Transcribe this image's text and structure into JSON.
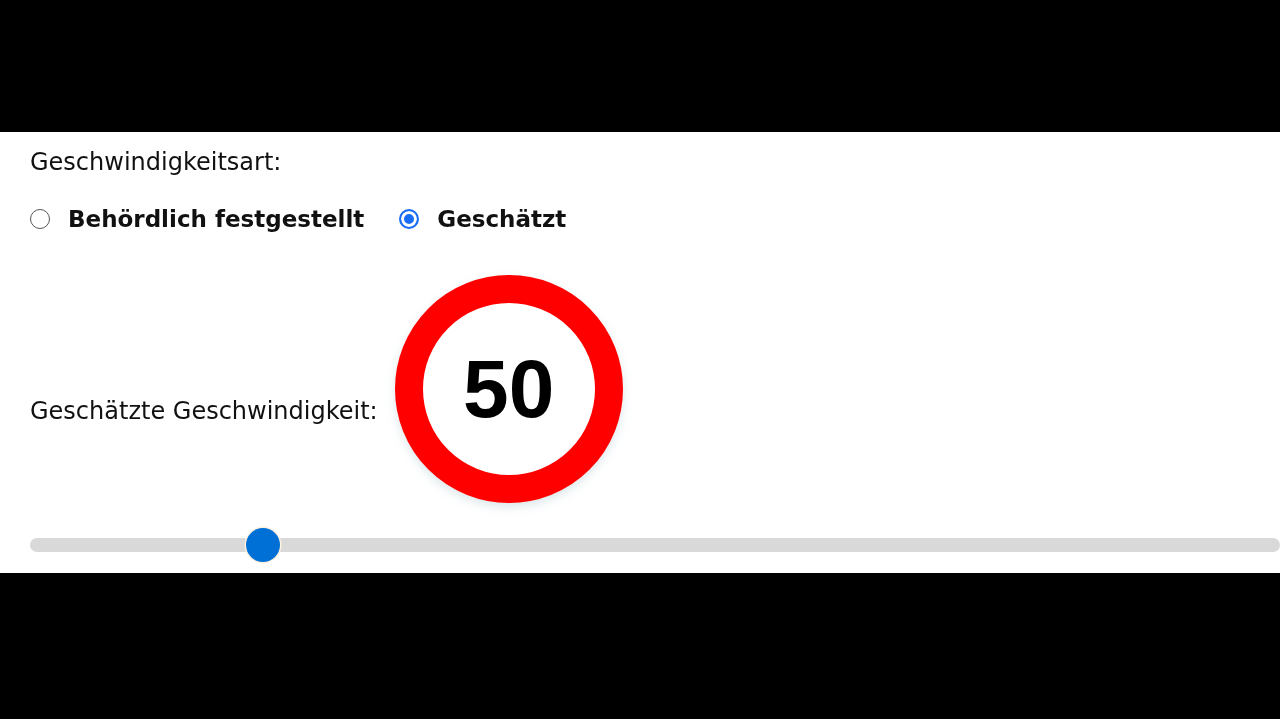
{
  "speed_type": {
    "label": "Geschwindigkeitsart:",
    "options": [
      {
        "label": "Behördlich festgestellt",
        "selected": false
      },
      {
        "label": "Geschätzt",
        "selected": true
      }
    ]
  },
  "estimated_speed": {
    "label": "Geschätzte Geschwindigkeit:",
    "sign": {
      "value": "50"
    },
    "slider": {
      "level": 0.186
    }
  }
}
